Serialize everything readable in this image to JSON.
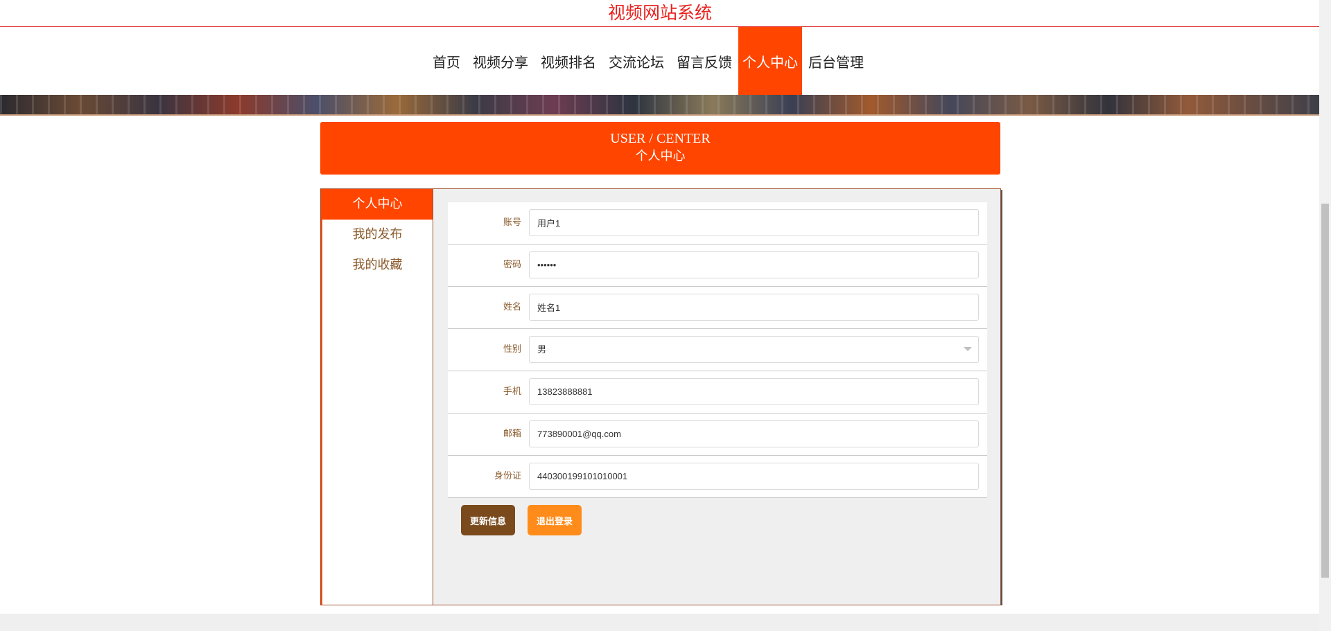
{
  "site": {
    "title": "视频网站系统"
  },
  "nav": {
    "items": [
      {
        "label": "首页",
        "active": false
      },
      {
        "label": "视频分享",
        "active": false
      },
      {
        "label": "视频排名",
        "active": false
      },
      {
        "label": "交流论坛",
        "active": false
      },
      {
        "label": "留言反馈",
        "active": false
      },
      {
        "label": "个人中心",
        "active": true
      },
      {
        "label": "后台管理",
        "active": false
      }
    ]
  },
  "page_header": {
    "title_en": "USER / CENTER",
    "title_cn": "个人中心"
  },
  "sidebar": {
    "items": [
      {
        "label": "个人中心",
        "active": true
      },
      {
        "label": "我的发布",
        "active": false
      },
      {
        "label": "我的收藏",
        "active": false
      }
    ]
  },
  "form": {
    "account": {
      "label": "账号",
      "value": "用户1"
    },
    "password": {
      "label": "密码",
      "value": "••••••"
    },
    "name": {
      "label": "姓名",
      "value": "姓名1"
    },
    "gender": {
      "label": "性别",
      "value": "男"
    },
    "phone": {
      "label": "手机",
      "value": "13823888881"
    },
    "email": {
      "label": "邮箱",
      "value": "773890001@qq.com"
    },
    "id_card": {
      "label": "身份证",
      "value": "440300199101010001"
    }
  },
  "buttons": {
    "update": "更新信息",
    "logout": "退出登录"
  },
  "colors": {
    "accent": "#ff4500",
    "brown": "#7a4a1d",
    "orange": "#ff8c1a",
    "title_red": "#e8201c"
  }
}
